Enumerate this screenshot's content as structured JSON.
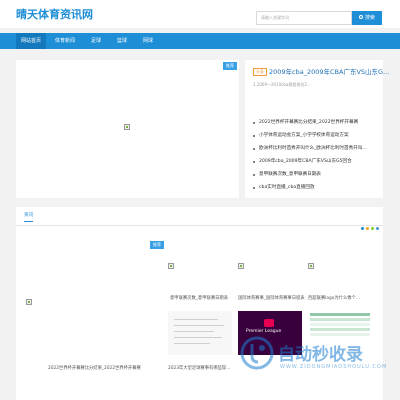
{
  "site": {
    "logo": "晴天体育资讯网"
  },
  "search": {
    "placeholder": "请输入关键字词",
    "button_label": "搜索"
  },
  "nav": {
    "items": [
      "网站首页",
      "体育新闻",
      "足球",
      "篮球",
      "网球"
    ],
    "active": 0
  },
  "feature": {
    "tag": "推荐"
  },
  "right_panel": {
    "tag": "头条",
    "title": "2009年cba_2009年CBA广东VS山东G...",
    "desc": "1.2009—2010cba赛程排名2...",
    "list": [
      "2022世界杯开幕赛比分结果_2022世界杯开幕赛",
      "小学体育运动会方案_小学学校体育运动方案",
      "欧洲杯比利时首秀开叫什么_欧洲杯比利时首秀开叫...",
      "2009年cba_2009年CBA广东VS山东G5回合",
      "意甲联赛次数_意甲联赛日期表",
      "cba实时直播_cba直播回放"
    ]
  },
  "news": {
    "tab": "资讯",
    "big_tag": "推荐",
    "captions": {
      "c1": "意甲联赛次数_意甲联赛日期表",
      "c2": "国际体育赛事_国际体育赛事日程表",
      "c3": "西超联赛logo为什么像个...",
      "c4": "2022世界杯开幕赛比分结果_2022世界杯开幕赛",
      "c5": "2023年大型足球赛事有哪些现..."
    },
    "premier_text": "Premier League"
  },
  "watermark": {
    "main": "自动秒收录",
    "sub": "WWW.ZIDONGMIAOSHOULU.COM"
  },
  "colors": {
    "accent": "#1e8ed6",
    "nav_active": "#1478bc",
    "tag_orange": "#f59a3a",
    "dot_colors": [
      "#1e8ed6",
      "#f5a623",
      "#7ed321",
      "#4a90e2"
    ]
  }
}
